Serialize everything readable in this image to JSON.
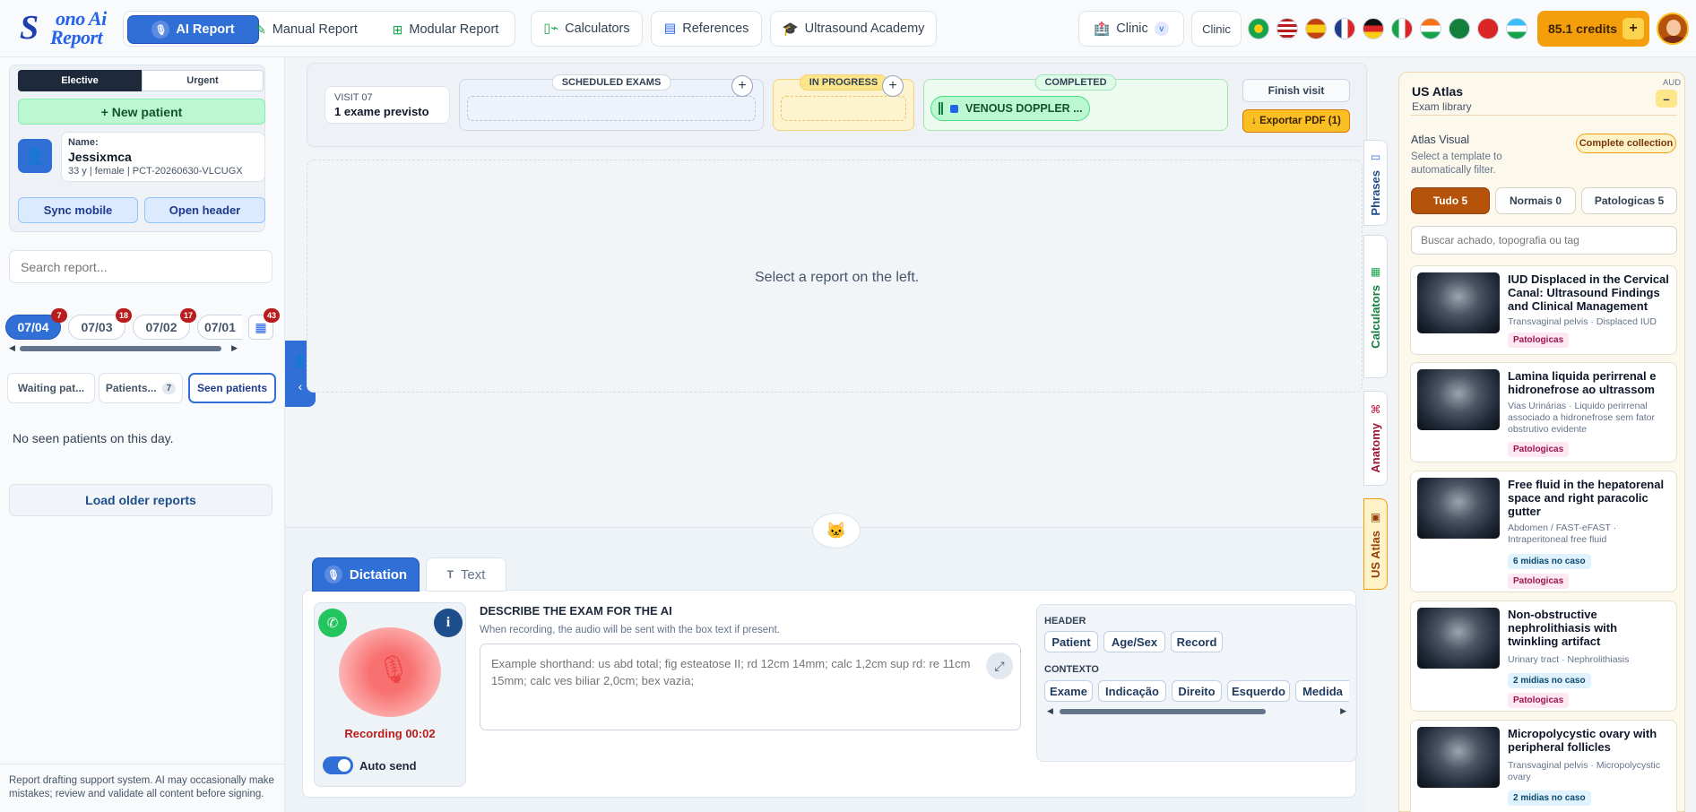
{
  "brand": {
    "logo_line1": "ono Ai",
    "logo_line2": "Report",
    "logo_letter": "S"
  },
  "nav": {
    "ai_report": "AI Report",
    "manual_report": "Manual Report",
    "modular_report": "Modular Report",
    "calculators": "Calculators",
    "references": "References",
    "academy": "Ultrasound Academy",
    "clinic_select": "Clinic",
    "clinic_caret": "v",
    "clinic_button": "Clinic",
    "credits": "85.1 credits",
    "credits_plus": "+"
  },
  "left": {
    "mode_elective": "Elective",
    "mode_urgent": "Urgent",
    "new_patient": "+ New patient",
    "name_label": "Name:",
    "patient_name": "Jessixmca",
    "patient_meta": "33 y | female | PCT-20260630-VLCUGX",
    "sync_mobile": "Sync mobile",
    "open_header": "Open header",
    "search_placeholder": "Search report...",
    "dates": [
      {
        "label": "07/04",
        "count": "7"
      },
      {
        "label": "07/03",
        "count": "18"
      },
      {
        "label": "07/02",
        "count": "17"
      },
      {
        "label": "07/01",
        "count": ""
      }
    ],
    "calendar_count": "43",
    "tab_waiting": "Waiting pat...",
    "tab_patients": "Patients...",
    "tab_patients_count": "7",
    "tab_seen": "Seen patients",
    "empty_msg": "No seen patients on this day.",
    "load_older": "Load older reports",
    "disclaimer": "Report drafting support system. AI may occasionally make mistakes; review and validate all content before signing."
  },
  "visit": {
    "label": "VISIT 07",
    "planned": "1 exame previsto",
    "scheduled": "SCHEDULED EXAMS",
    "in_progress": "IN PROGRESS",
    "completed": "COMPLETED",
    "completed_exam": "VENOUS DOPPLER ...",
    "finish": "Finish visit",
    "export": "↓ Exportar PDF (1)",
    "plus": "+"
  },
  "center": {
    "placeholder": "Select a report on the left."
  },
  "compose": {
    "tab_dictation": "Dictation",
    "tab_text": "Text",
    "text_icon": "T",
    "info": "i",
    "recording": "Recording 00:02",
    "auto_send": "Auto send",
    "title": "DESCRIBE THE EXAM FOR THE AI",
    "subtitle": "When recording, the audio will be sent with the box text if present.",
    "placeholder": "Example shorthand: us abd total; fig esteatose II; rd 12cm 14mm; calc 1,2cm sup rd: re 11cm 15mm; calc ves biliar 2,0cm; bex vazia;",
    "header_label": "HEADER",
    "header_chips": [
      "Patient",
      "Age/Sex",
      "Record"
    ],
    "context_label": "CONTEXTO",
    "context_chips": [
      "Exame",
      "Indicação",
      "Direito",
      "Esquerdo",
      "Medida"
    ]
  },
  "side_tabs": {
    "phrases": "Phrases",
    "calculators": "Calculators",
    "anatomy": "Anatomy",
    "atlas": "US Atlas"
  },
  "atlas": {
    "title": "US Atlas",
    "subtitle": "Exam library",
    "corner": "AUD",
    "collapse": "–",
    "visual_title": "Atlas Visual",
    "visual_desc": "Select a template to automatically filter.",
    "complete": "Complete collection",
    "filter_all": "Tudo 5",
    "filter_normal": "Normais 0",
    "filter_path": "Patologicas 5",
    "search_placeholder": "Buscar achado, topografia ou tag",
    "items": [
      {
        "title": "IUD Displaced in the Cervical Canal: Ultrasound Findings and Clinical Management",
        "sub": "Transvaginal pelvis · Displaced IUD",
        "media": "",
        "tag": "Patologicas"
      },
      {
        "title": "Lamina liquida perirrenal e hidronefrose ao ultrassom",
        "sub": "Vias Urinárias · Liquido perirrenal associado a hidronefrose sem fator obstrutivo evidente",
        "media": "",
        "tag": "Patologicas"
      },
      {
        "title": "Free fluid in the hepatorenal space and right paracolic gutter",
        "sub": "Abdomen / FAST-eFAST · Intraperitoneal free fluid",
        "media": "6 midias no caso",
        "tag": "Patologicas"
      },
      {
        "title": "Non-obstructive nephrolithiasis with twinkling artifact",
        "sub": "Urinary tract · Nephrolithiasis",
        "media": "2 midias no caso",
        "tag": "Patologicas"
      },
      {
        "title": "Micropolycystic ovary with peripheral follicles",
        "sub": "Transvaginal pelvis · Micropolycystic ovary",
        "media": "2 midias no caso",
        "tag": ""
      }
    ]
  },
  "colors": {
    "primary": "#2f6fd6",
    "success": "#86efac",
    "warning": "#f59e0b",
    "danger": "#b91c1c",
    "record": "#f87171"
  }
}
